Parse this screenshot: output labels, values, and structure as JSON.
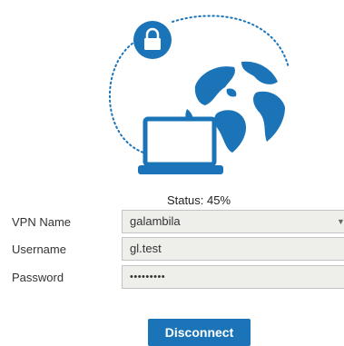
{
  "status": {
    "text": "Status: 45%",
    "progress_percent": 45
  },
  "form": {
    "vpn_name": {
      "label": "VPN Name",
      "value": "galambila"
    },
    "username": {
      "label": "Username",
      "value": "gl.test"
    },
    "password": {
      "label": "Password",
      "masked_value": "•••••••••"
    }
  },
  "actions": {
    "disconnect_label": "Disconnect"
  },
  "icons": {
    "lock": "lock-icon",
    "globe": "globe-icon",
    "laptop": "laptop-icon",
    "dropdown": "chevron-down-icon"
  },
  "colors": {
    "accent": "#1c74b8",
    "field_bg": "#eeeeeb"
  }
}
